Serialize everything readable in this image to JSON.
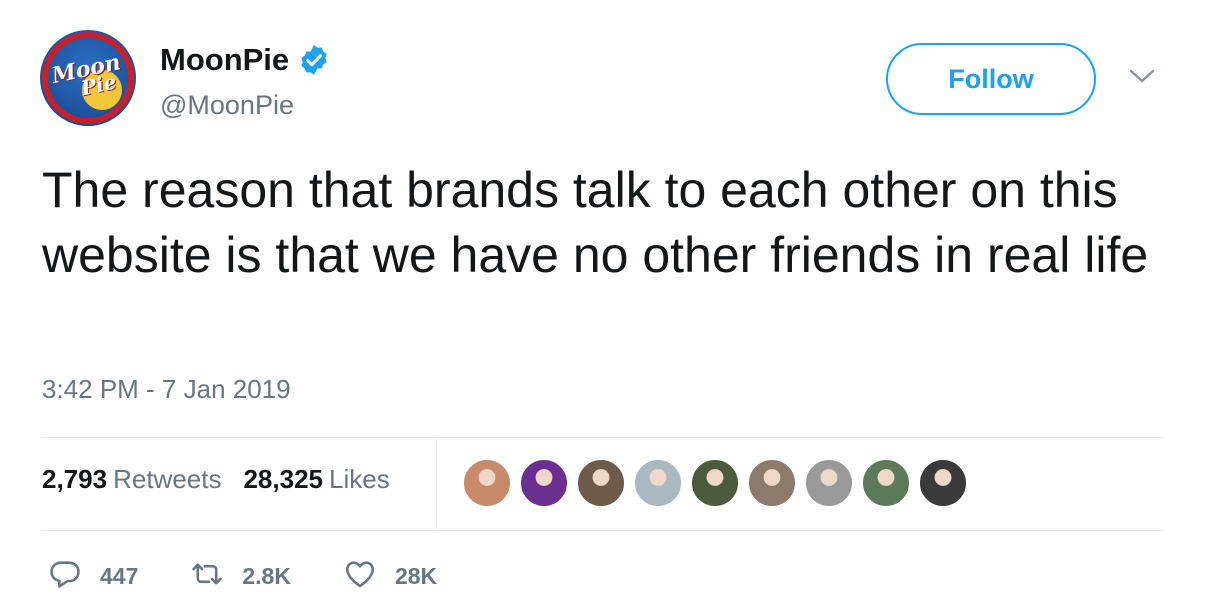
{
  "author": {
    "display_name": "MoonPie",
    "handle": "@MoonPie",
    "verified": true,
    "avatar_logo_lines": [
      "Moon",
      "Pie"
    ]
  },
  "follow_button": {
    "label": "Follow"
  },
  "tweet": {
    "text": "The reason that brands talk to each other on this website is that we have no other friends in real life",
    "timestamp": "3:42 PM - 7 Jan 2019"
  },
  "stats": {
    "retweets_count": "2,793",
    "retweets_label": "Retweets",
    "likes_count": "28,325",
    "likes_label": "Likes"
  },
  "likers": [
    {
      "name": "liker-avatar-1",
      "color": "#c98a6a"
    },
    {
      "name": "liker-avatar-2",
      "color": "#6b2f8f"
    },
    {
      "name": "liker-avatar-3",
      "color": "#6e5a48"
    },
    {
      "name": "liker-avatar-4",
      "color": "#aab8c2"
    },
    {
      "name": "liker-avatar-5",
      "color": "#4a5a3a"
    },
    {
      "name": "liker-avatar-6",
      "color": "#8c7a6a"
    },
    {
      "name": "liker-avatar-7",
      "color": "#9a9a9a"
    },
    {
      "name": "liker-avatar-8",
      "color": "#5a7a5a"
    },
    {
      "name": "liker-avatar-9",
      "color": "#3a3a3a"
    }
  ],
  "actions": {
    "reply_count": "447",
    "retweet_count": "2.8K",
    "like_count": "28K"
  },
  "colors": {
    "accent": "#1da1f2",
    "text_primary": "#14171a",
    "text_secondary": "#657786",
    "divider": "#e6ecf0"
  },
  "icons": {
    "verified": "verified-badge-icon",
    "caret": "chevron-down-icon",
    "reply": "reply-icon",
    "retweet": "retweet-icon",
    "like": "heart-icon"
  }
}
